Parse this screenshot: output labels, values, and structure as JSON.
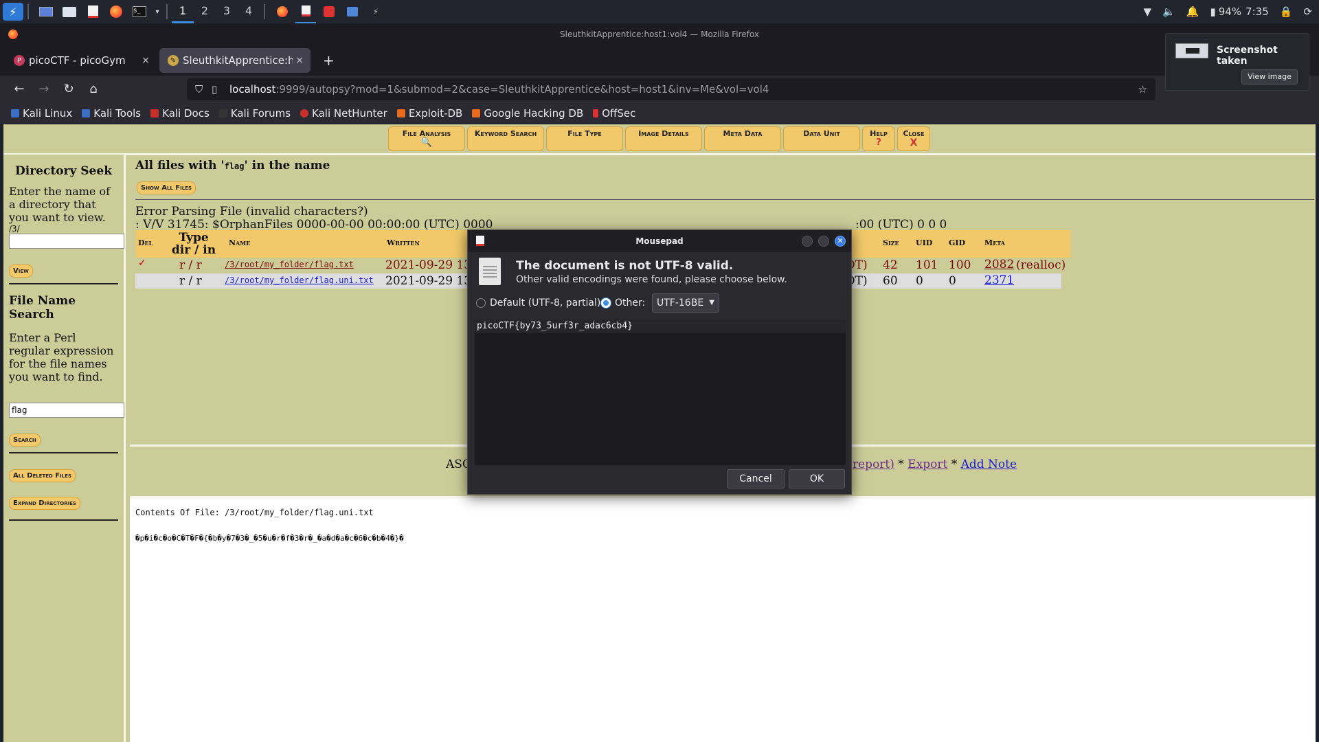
{
  "panel": {
    "workspaces": [
      "1",
      "2",
      "3",
      "4"
    ],
    "active_workspace": "1",
    "battery": "94%",
    "time": "7:35",
    "icons": [
      "kali-menu-icon",
      "desktop-icon",
      "files-icon",
      "text-editor-icon",
      "firefox-icon",
      "terminal-icon"
    ]
  },
  "firefox": {
    "window_title": "SleuthkitApprentice:host1:vol4 — Mozilla Firefox",
    "tabs": [
      {
        "label": "picoCTF - picoGym",
        "close": "×"
      },
      {
        "label": "SleuthkitApprentice:host1",
        "close": "×"
      }
    ],
    "new_tab": "+",
    "url_host": "localhost",
    "url_rest": ":9999/autopsy?mod=1&submod=2&case=SleuthkitApprentice&host=host1&inv=Me&vol=vol4",
    "bookmarks": [
      "Kali Linux",
      "Kali Tools",
      "Kali Docs",
      "Kali Forums",
      "Kali NetHunter",
      "Exploit-DB",
      "Google Hacking DB",
      "OffSec"
    ]
  },
  "autopsy": {
    "menu": [
      "File Analysis",
      "Keyword Search",
      "File Type",
      "Image Details",
      "Meta Data",
      "Data Unit",
      "Help",
      "Close"
    ],
    "help_glyph": "?",
    "close_glyph": "X",
    "left": {
      "dir_title": "Directory Seek",
      "dir_desc": "Enter the name of a directory that you want to view.",
      "dir_prefix": "/3/",
      "dir_value": "",
      "view_btn": "View",
      "fn_title": "File Name Search",
      "fn_desc": "Enter a Perl regular expression for the file names you want to find.",
      "fn_value": "flag",
      "search_btn": "Search",
      "deleted_btn": "All Deleted Files",
      "expand_btn": "Expand Directories"
    },
    "results": {
      "heading_pre": "All files with '",
      "heading_term": "flag",
      "heading_post": "' in the name",
      "show_all_btn": "Show All Files",
      "error_line1": "Error Parsing File (invalid characters?)",
      "error_line2_left": ": V/V 31745: $OrphanFiles 0000-00-00 00:00:00 (UTC) 0000",
      "error_line2_right": ":00 (UTC) 0 0 0",
      "columns": [
        "Del",
        "Type dir / in",
        "Name",
        "Written",
        "Size",
        "UID",
        "GID",
        "Meta"
      ],
      "rows": [
        {
          "del": "✓",
          "type": "r / r",
          "name": "/3/root/my_folder/flag.txt",
          "written": "2021-09-29 13:",
          "tail": "DT)",
          "size": "42",
          "uid": "101",
          "gid": "100",
          "meta": "2082",
          "meta_note": "(realloc)"
        },
        {
          "del": "",
          "type": "r / r",
          "name": "/3/root/my_folder/flag.uni.txt",
          "written": "2021-09-29 13:",
          "tail": "DT)",
          "size": "60",
          "uid": "0",
          "gid": "0",
          "meta": "2371",
          "meta_note": ""
        }
      ]
    },
    "report_bar": {
      "prefix": "ASC",
      "report_tail": "report)",
      "sep1": " * ",
      "export": "Export",
      "sep2": " * ",
      "add_note": "Add Note"
    },
    "contents": {
      "label": "Contents Of File: /3/root/my_folder/flag.uni.txt",
      "data": "�p�i�c�o�C�T�F�{�b�y�7�3�_�5�u�r�f�3�r�_�a�d�a�c�6�c�b�4�}�"
    }
  },
  "dialog": {
    "title": "Mousepad",
    "heading": "The document is not UTF-8 valid.",
    "subtext": "Other valid encodings were found, please choose below.",
    "radio_default": "Default (UTF-8, partial)",
    "radio_other": "Other:",
    "encoding": "UTF-16BE",
    "text": "picoCTF{by73_5urf3r_adac6cb4}",
    "cancel": "Cancel",
    "ok": "OK",
    "close_glyph": "✕"
  },
  "notification": {
    "title": "Screenshot taken",
    "button": "View image"
  },
  "colors": {
    "autopsy_bg": "#cccc99",
    "menu_btn": "#f2c96a",
    "link": "#1a1ad6",
    "dialog_bg": "#2a2a2e",
    "accent": "#3c8fe6"
  }
}
